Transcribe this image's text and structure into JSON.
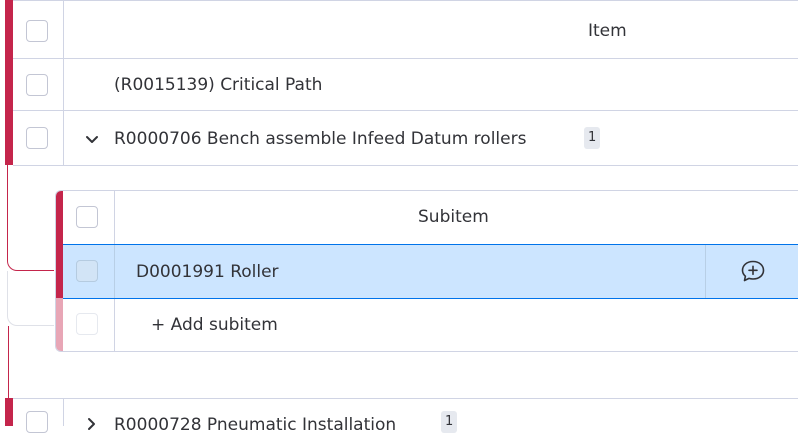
{
  "board": {
    "column_header": "Item",
    "rows": [
      {
        "label": "(R0015139) Critical Path"
      },
      {
        "label": "R0000706 Bench assemble Infeed Datum rollers",
        "subitem_count": "1"
      },
      {
        "label": "R0000728 Pneumatic Installation",
        "subitem_count": "1"
      }
    ]
  },
  "subitems": {
    "column_header": "Subitem",
    "rows": [
      {
        "label": "D0001991 Roller"
      }
    ],
    "add_label": "+ Add subitem"
  },
  "icons": {
    "expand": "chevron-down-icon",
    "collapsed": "chevron-right-icon",
    "add_update": "add-update-icon"
  },
  "colors": {
    "group_accent": "#c4254b",
    "selected_row": "#cce5ff",
    "selected_border": "#0073ea"
  }
}
